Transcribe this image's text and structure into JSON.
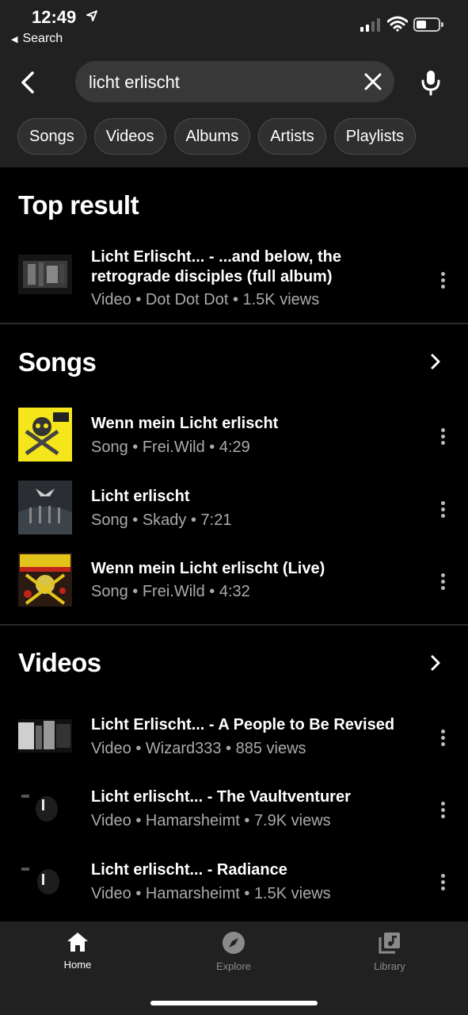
{
  "status": {
    "time": "12:49",
    "back_app": "Search"
  },
  "search": {
    "query": "licht erlischt",
    "chips": [
      "Songs",
      "Videos",
      "Albums",
      "Artists",
      "Playlists"
    ]
  },
  "top_result": {
    "heading": "Top result",
    "item": {
      "title_line1": "Licht Erlischt... - ...and below, the",
      "title_line2": "retrograde disciples (full album)",
      "subtitle": "Video • Dot Dot Dot • 1.5K views"
    }
  },
  "songs": {
    "heading": "Songs",
    "items": [
      {
        "title": "Wenn mein Licht erlischt",
        "subtitle": "Song • Frei.Wild • 4:29"
      },
      {
        "title": "Licht erlischt",
        "subtitle": "Song • Skady • 7:21"
      },
      {
        "title": "Wenn mein Licht erlischt (Live)",
        "subtitle": "Song • Frei.Wild • 4:32"
      }
    ]
  },
  "videos": {
    "heading": "Videos",
    "items": [
      {
        "title": "Licht Erlischt... - A People to Be Revised",
        "subtitle": "Video • Wizard333 • 885 views"
      },
      {
        "title": "Licht erlischt... - The Vaultventurer",
        "subtitle": "Video • Hamarsheimt • 7.9K views"
      },
      {
        "title": "Licht erlischt... - Radiance",
        "subtitle": "Video • Hamarsheimt • 1.5K views"
      }
    ]
  },
  "nav": {
    "items": [
      {
        "label": "Home",
        "icon": "home-icon",
        "active": true
      },
      {
        "label": "Explore",
        "icon": "compass-icon",
        "active": false
      },
      {
        "label": "Library",
        "icon": "library-icon",
        "active": false
      }
    ]
  },
  "colors": {
    "background": "#000000",
    "header": "#212121",
    "muted_text": "#aaaaaa",
    "inactive_nav": "#8a8a8a"
  }
}
